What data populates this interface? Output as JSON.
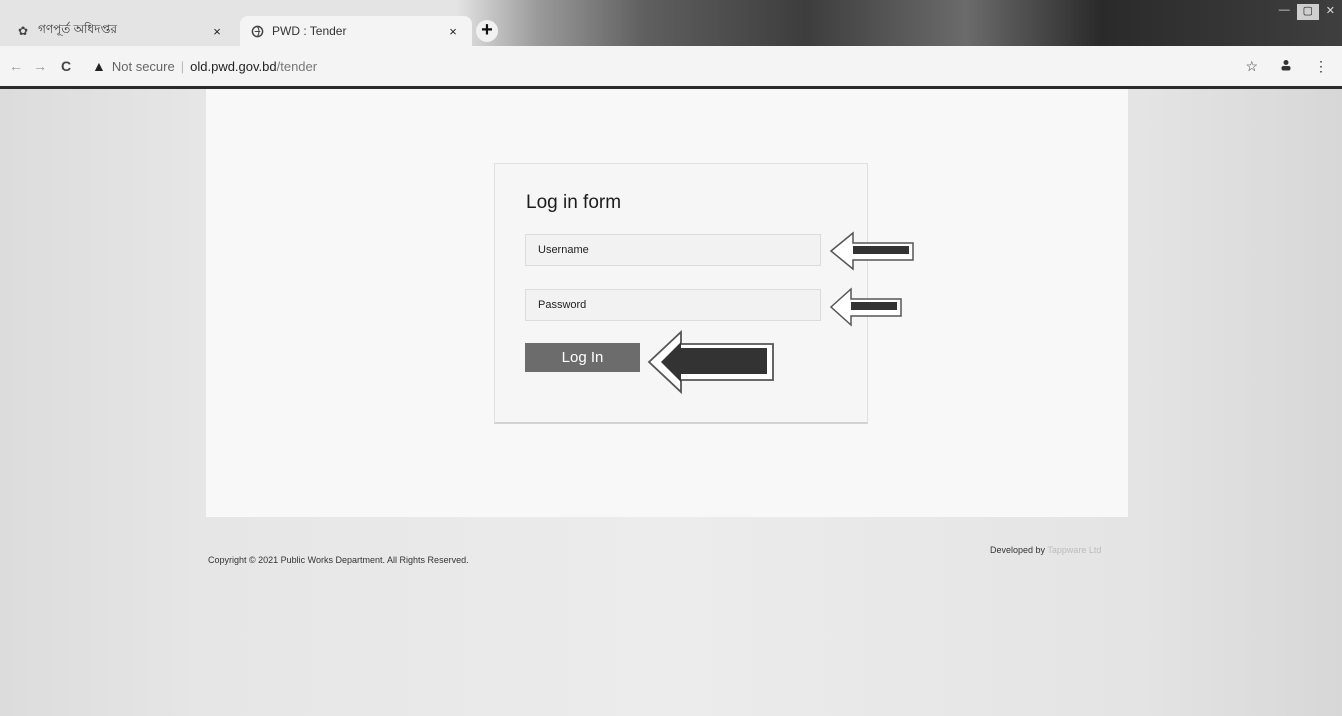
{
  "browser": {
    "tabs": [
      {
        "label": "গণপূর্ত অধিদপ্তর",
        "close": "×"
      },
      {
        "label": "PWD : Tender",
        "close": "×"
      }
    ],
    "new_tab": "+",
    "toolbar": {
      "security_text": "Not secure",
      "url_host": "old.pwd.gov.bd",
      "url_path": "/tender"
    }
  },
  "login": {
    "title": "Log in form",
    "username_placeholder": "Username",
    "password_placeholder": "Password",
    "button_label": "Log In"
  },
  "footer": {
    "copyright": "Copyright © 2021 Public Works Department. All Rights Reserved.",
    "developed_label": "Developed by",
    "developer": "Tappware Ltd"
  },
  "colors": {
    "button": "#6c6c6c",
    "page_bg": "#e9e9e9",
    "form_bg": "#f6f6f6"
  }
}
